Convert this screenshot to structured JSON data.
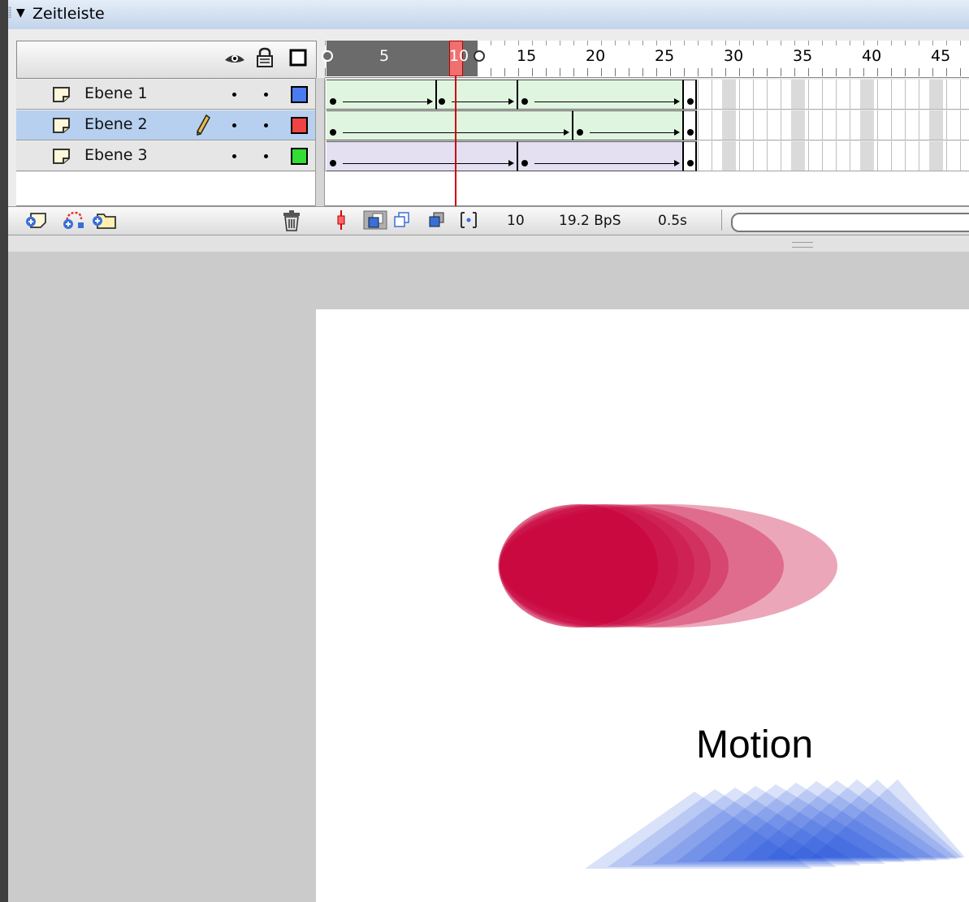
{
  "panel": {
    "title": "Zeitleiste",
    "collapse_icon": "triangle-down-icon",
    "grip_icon": "grip-icon"
  },
  "layer_header": {
    "icons": [
      "eye-icon",
      "lock-icon",
      "outline-icon"
    ]
  },
  "layers": [
    {
      "name": "Ebene 1",
      "color": "#4a7bef",
      "selected": false,
      "editing": false
    },
    {
      "name": "Ebene 2",
      "color": "#ee4444",
      "selected": true,
      "editing": true
    },
    {
      "name": "Ebene 3",
      "color": "#33dd33",
      "selected": false,
      "editing": false
    }
  ],
  "ruler": {
    "labels": [
      "5",
      "1",
      "0",
      "15",
      "20",
      "25",
      "30",
      "35",
      "40",
      "45"
    ],
    "current_frame": 10
  },
  "toolbar": {
    "left_icons": [
      "insert-layer-icon",
      "add-motion-guide-icon",
      "insert-folder-icon"
    ],
    "delete_icon": "trash-icon",
    "center_icon": "center-frame-icon",
    "onion_icons": [
      "onion-skin-icon",
      "onion-outlines-icon",
      "edit-multiple-frames-icon",
      "modify-onion-markers-icon"
    ],
    "current_frame": "10",
    "frame_rate": "19.2 BpS",
    "elapsed": "0.5s"
  },
  "stage": {
    "label": "Motion",
    "ellipse_color": "#c8003a",
    "triangle_color": "#0a3ad8"
  }
}
